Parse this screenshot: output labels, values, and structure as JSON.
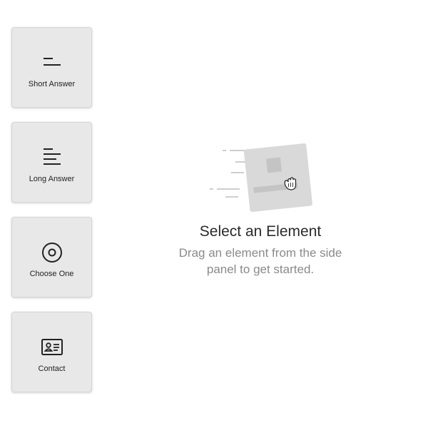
{
  "side_panel": {
    "items": [
      {
        "label": "Short Answer",
        "icon": "short-answer-icon"
      },
      {
        "label": "Long Answer",
        "icon": "long-answer-icon"
      },
      {
        "label": "Choose One",
        "icon": "radio-circle-icon"
      },
      {
        "label": "Contact",
        "icon": "contact-card-icon"
      }
    ]
  },
  "empty_state": {
    "title": "Select an Element",
    "description": "Drag an element from the side panel to get started.",
    "illustration": "drag-card-illustration"
  },
  "colors": {
    "card_bg": "#e8e8e8",
    "icon": "#222222",
    "title": "#2a2a2a",
    "description": "#8a8a8a",
    "illustration": "#d9d9d9"
  }
}
